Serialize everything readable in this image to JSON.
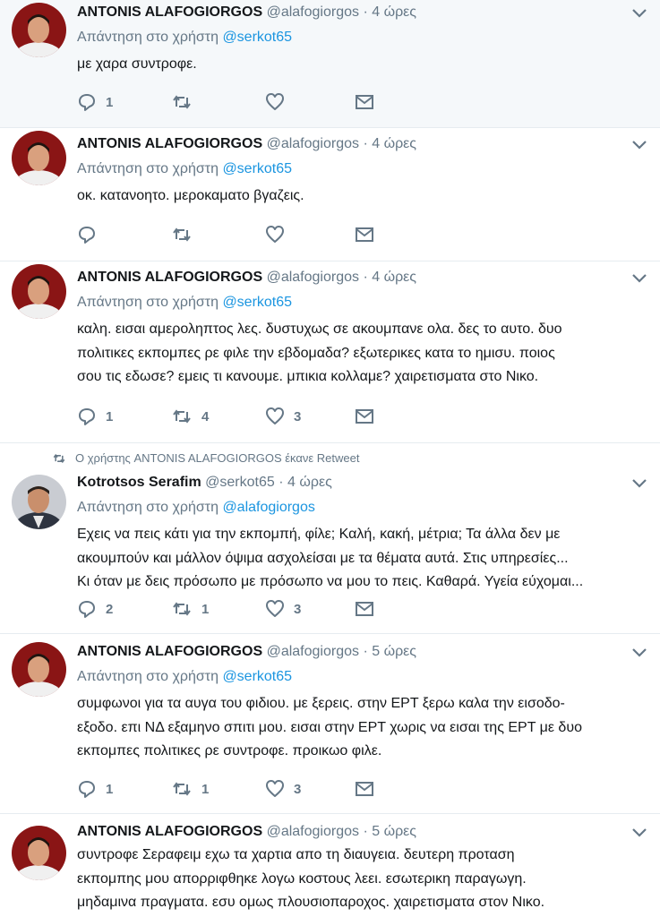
{
  "reply_prefix": "Απάντηση στο χρήστη",
  "tweets": [
    {
      "name": "ANTONIS ALAFOGIORGOS",
      "handle": "@alafogiorgos",
      "time": "4 ώρες",
      "reply_to": "@serkot65",
      "text": [
        "με χαρα συντροφε."
      ],
      "replies": "1",
      "retweets": "",
      "likes": ""
    },
    {
      "name": "ANTONIS ALAFOGIORGOS",
      "handle": "@alafogiorgos",
      "time": "4 ώρες",
      "reply_to": "@serkot65",
      "text": [
        "οκ. κατανοητο. μεροκαματο βγαζεις."
      ],
      "replies": "",
      "retweets": "",
      "likes": ""
    },
    {
      "name": "ANTONIS ALAFOGIORGOS",
      "handle": "@alafogiorgos",
      "time": "4 ώρες",
      "reply_to": "@serkot65",
      "text": [
        "καλη. εισαι αμεροληπτος λες. δυστυχως σε ακουμπανε ολα. δες το αυτο. δυο",
        "πολιτικες εκπομπες ρε φιλε την εβδομαδα? εξωτερικες κατα το ημισυ. ποιος",
        "σου τις εδωσε? εμεις τι κανουμε. μπικια κολλαμε? χαιρετισματα στο Νικο."
      ],
      "replies": "1",
      "retweets": "4",
      "likes": "3"
    },
    {
      "retweet_context": "Ο χρήστης ANTONIS ALAFOGIORGOS έκανε Retweet",
      "name": "Kotrotsos Serafim",
      "handle": "@serkot65",
      "time": "4 ώρες",
      "reply_to": "@alafogiorgos",
      "text": [
        "Εχεις να πεις κάτι για την εκπομπή, φίλε; Καλή, κακή, μέτρια; Τα άλλα δεν με",
        "ακουμπούν και μάλλον όψιμα ασχολείσαι με τα θέματα αυτά. Στις υπηρεσίες...",
        "Κι όταν με δεις πρόσωπο με πρόσωπο να μου το πεις. Καθαρά. Υγεία εύχομαι..."
      ],
      "replies": "2",
      "retweets": "1",
      "likes": "3"
    },
    {
      "name": "ANTONIS ALAFOGIORGOS",
      "handle": "@alafogiorgos",
      "time": "5 ώρες",
      "reply_to": "@serkot65",
      "text": [
        "συμφωνοι για τα αυγα του φιδιου. με ξερεις. στην ΕΡΤ ξερω καλα την εισοδο-",
        "εξοδο. επι ΝΔ εξαμηνο σπιτι μου. εισαι στην ΕΡΤ χωρις να εισαι της ΕΡΤ με δυο",
        "εκπομπες πολιτικες ρε συντροφε. προικωο φιλε."
      ],
      "replies": "1",
      "retweets": "1",
      "likes": "3"
    },
    {
      "name": "ANTONIS ALAFOGIORGOS",
      "handle": "@alafogiorgos",
      "time": "5 ώρες",
      "reply_to": "",
      "text": [
        "συντροφε Σεραφειμ εχω τα χαρτια απο τη διαυγεια. δευτερη προταση",
        "εκπομπης μου απορριφθηκε λογω κοστους λεει. εσωτερικη παραγωγη.",
        "μηδαμινα πραγματα. εσυ ομως πλουσιοπαροχος. χαιρετισματα στον Νικο."
      ]
    }
  ]
}
